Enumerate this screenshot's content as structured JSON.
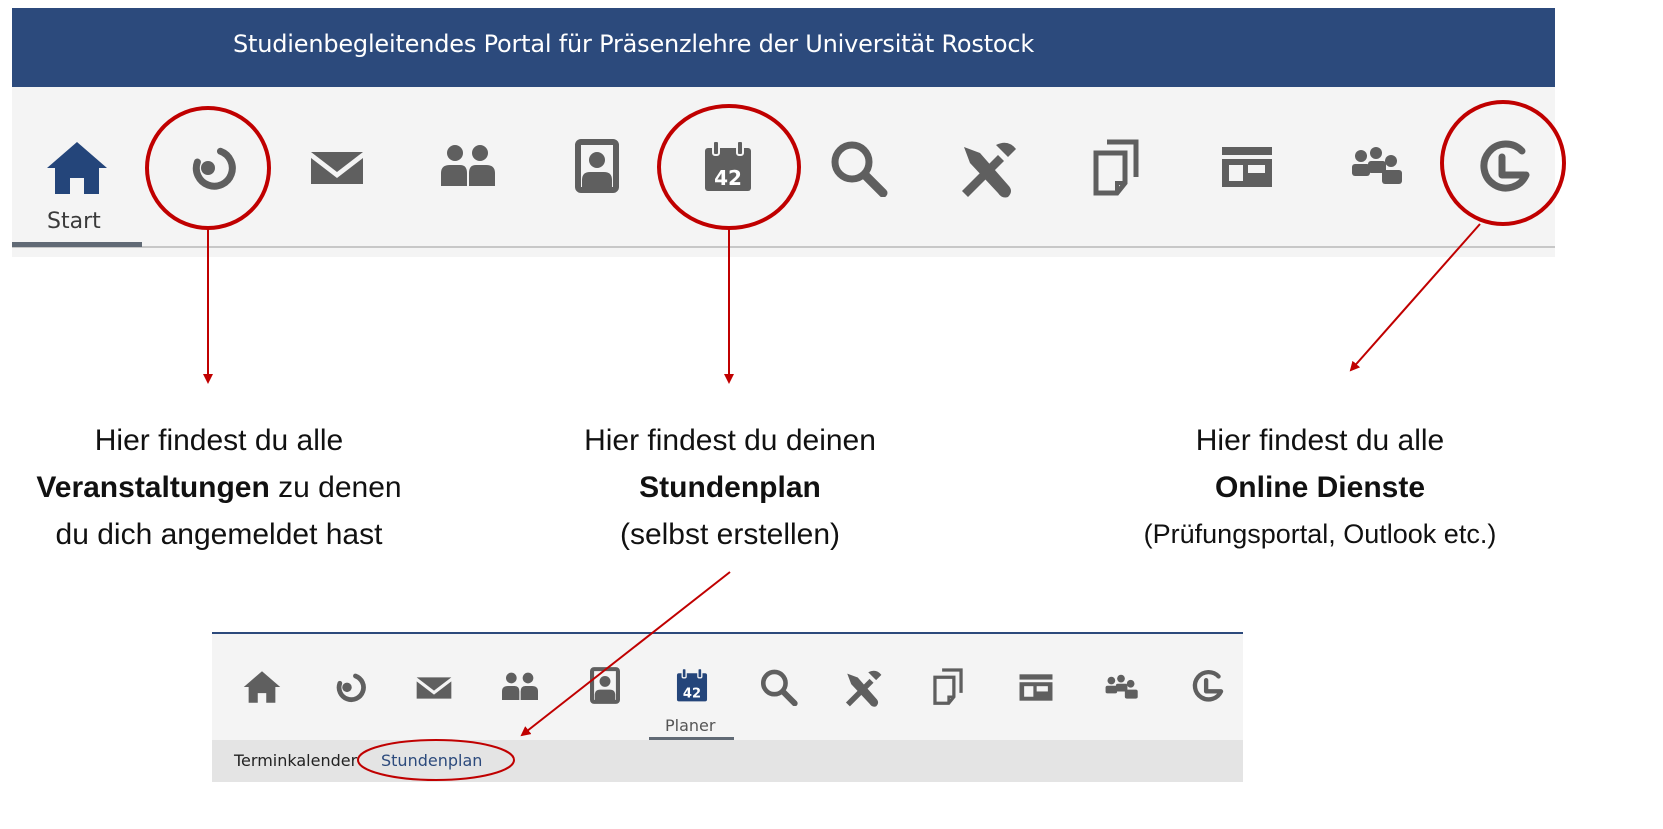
{
  "banner": {
    "title": "Studienbegleitendes Portal für Präsenzlehre der Universität Rostock"
  },
  "nav_top": {
    "active_label": "Start",
    "icons": [
      "home-icon",
      "portal-icon",
      "mail-icon",
      "people-icon",
      "contact-card-icon",
      "calendar-icon",
      "search-icon",
      "tools-icon",
      "documents-icon",
      "layout-icon",
      "groups-icon",
      "online-services-icon"
    ]
  },
  "callouts": {
    "courses": {
      "line1": "Hier findest du alle",
      "bold": "Veranstaltungen",
      "line2_rest": " zu denen",
      "line3": "du dich angemeldet hast"
    },
    "schedule": {
      "line1": "Hier findest du deinen",
      "bold": "Stundenplan",
      "line3": "(selbst erstellen)"
    },
    "online": {
      "line1": "Hier findest du alle",
      "bold": "Online Dienste",
      "line3": "(Prüfungsportal, Outlook etc.)"
    }
  },
  "calendar_badge": "42",
  "nav_bottom": {
    "active_label": "Planer",
    "subnav": {
      "item1": "Terminkalender",
      "item2": "Stundenplan"
    }
  },
  "colors": {
    "banner": "#2c4a7c",
    "home_active": "#24457a",
    "icon_gray": "#5f5f5f",
    "annotation_red": "#c00000"
  }
}
